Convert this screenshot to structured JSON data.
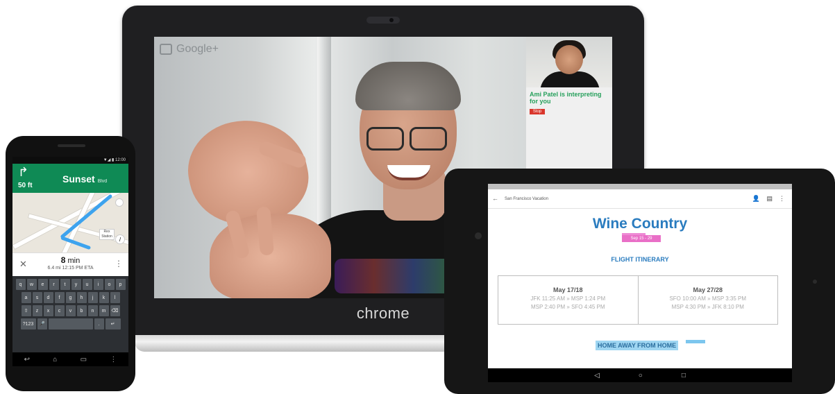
{
  "laptop": {
    "brand": "chrome",
    "hangout": {
      "logo_text": "Google+",
      "interpreter_message": "Ami Patel is interpreting for you",
      "stop_button": "Stop"
    }
  },
  "phone": {
    "status": "▼◢ ▮ 12:00",
    "nav": {
      "turn_icon": "turn-right-icon",
      "distance": "50 ft",
      "street": "Sunset",
      "street_suffix": "Blvd"
    },
    "map": {
      "label": "Rex Station"
    },
    "eta": {
      "time": "8",
      "time_unit": "min",
      "detail": "6.4 mi   12:15 PM ETA"
    },
    "keyboard": {
      "row1": [
        "q",
        "w",
        "e",
        "r",
        "t",
        "y",
        "u",
        "i",
        "o",
        "p"
      ],
      "row2": [
        "a",
        "s",
        "d",
        "f",
        "g",
        "h",
        "j",
        "k",
        "l"
      ],
      "row3": [
        "⇧",
        "z",
        "x",
        "c",
        "v",
        "b",
        "n",
        "m",
        "⌫"
      ],
      "row4": [
        "?123",
        "🎤",
        "",
        ".",
        "↵"
      ]
    },
    "navbar": [
      "↩",
      "⌂",
      "▭",
      "⋮"
    ]
  },
  "tablet": {
    "header": {
      "name": "San Francisco Vacation"
    },
    "doc": {
      "title": "Wine Country",
      "highlight": "Sep 15 - 29",
      "section1": "FLIGHT ITINERARY",
      "flights": [
        {
          "date": "May 17/18",
          "line1": "JFK 11:25 AM » MSP 1:24 PM",
          "line2": "MSP 2:40 PM » SFO 4:45 PM"
        },
        {
          "date": "May 27/28",
          "line1": "SFO 10:00 AM » MSP 3:35 PM",
          "line2": "MSP 4:30 PM » JFK 8:10 PM"
        }
      ],
      "section2": "HOME AWAY FROM HOME"
    },
    "navbar": [
      "◁",
      "○",
      "□"
    ]
  }
}
